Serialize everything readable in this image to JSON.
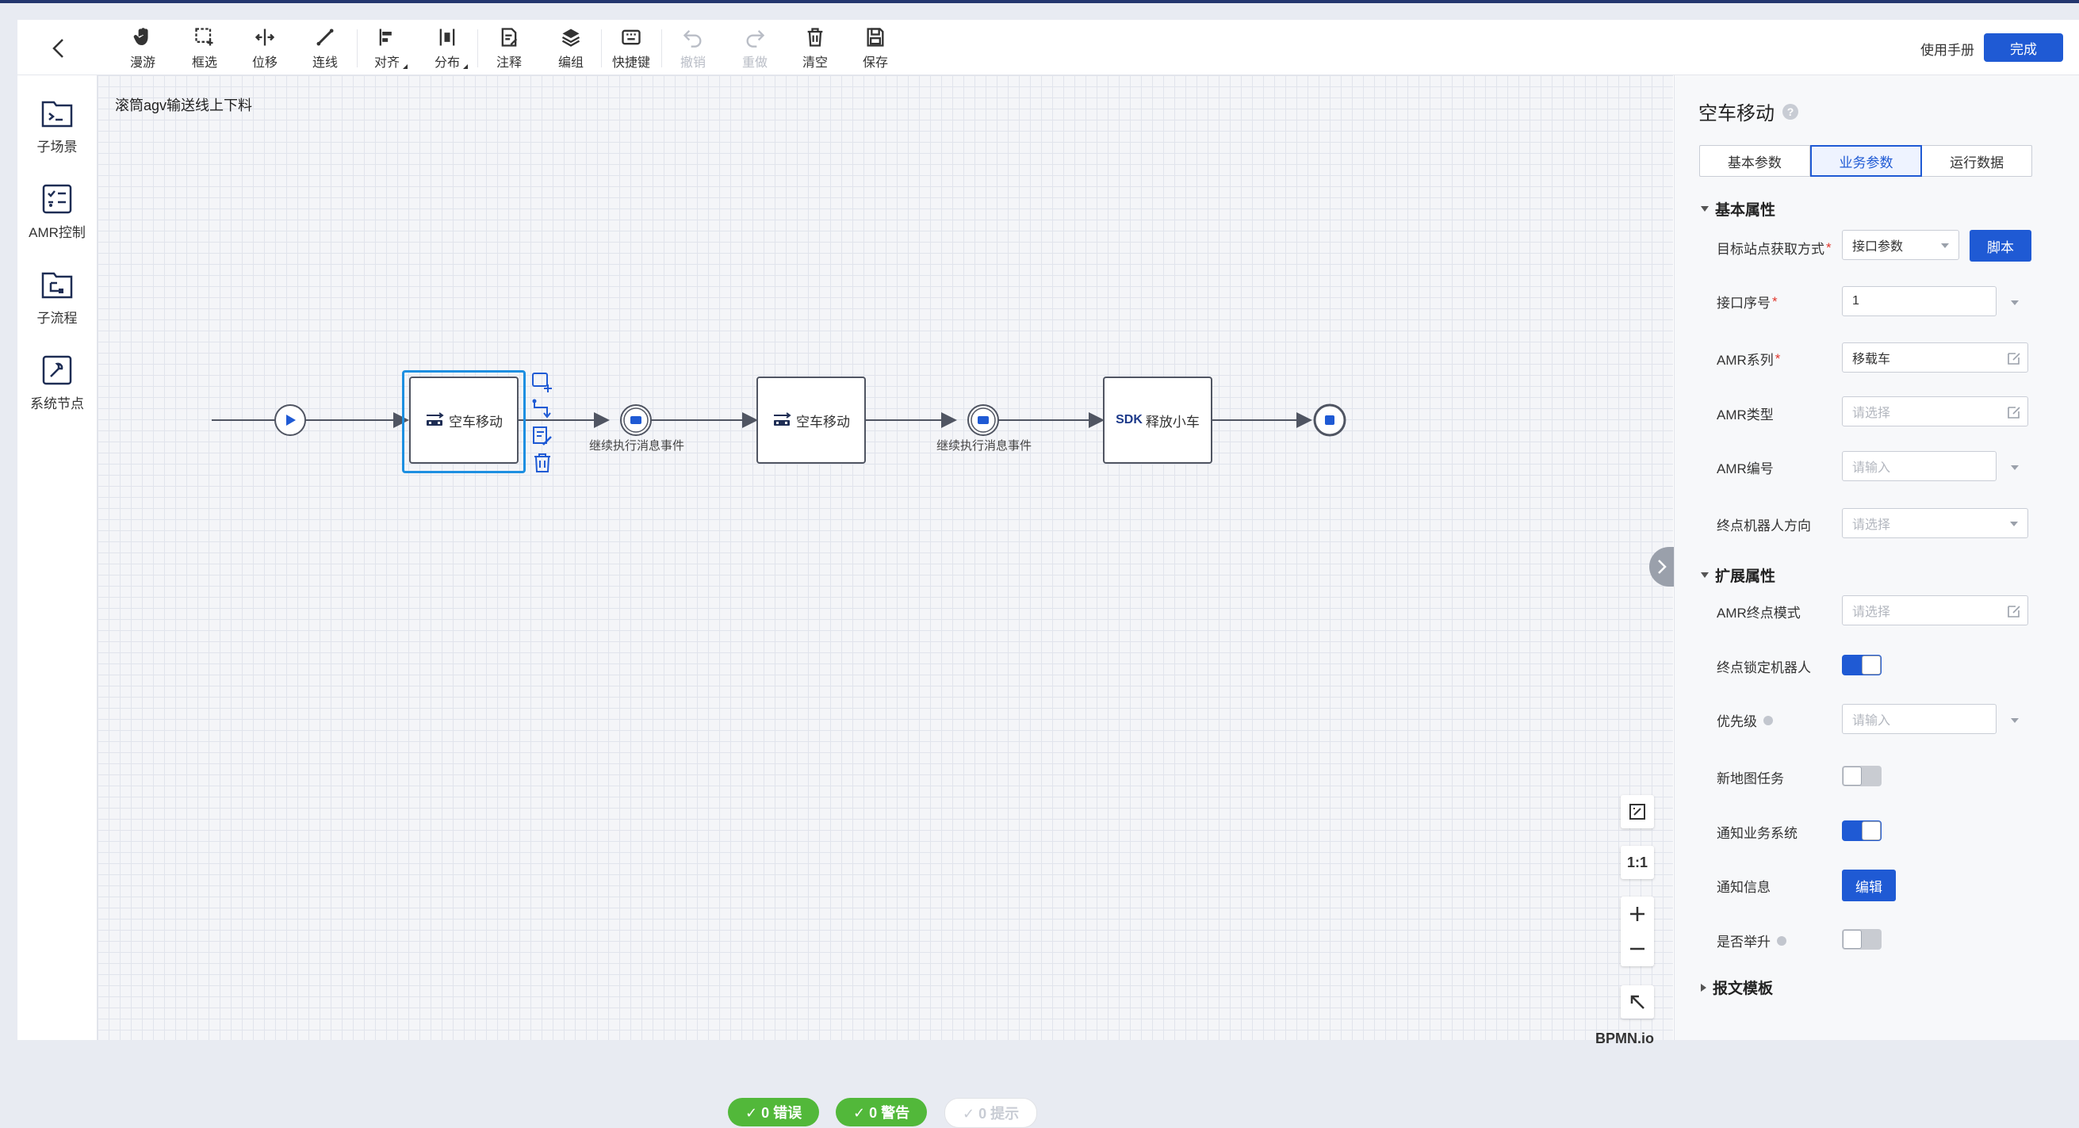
{
  "toolbar": {
    "tools": [
      {
        "id": "pan",
        "label": "漫游"
      },
      {
        "id": "marquee",
        "label": "框选"
      },
      {
        "id": "move",
        "label": "位移"
      },
      {
        "id": "connect",
        "label": "连线"
      },
      {
        "id": "align",
        "label": "对齐"
      },
      {
        "id": "distribute",
        "label": "分布"
      },
      {
        "id": "annotate",
        "label": "注释"
      },
      {
        "id": "group",
        "label": "编组"
      },
      {
        "id": "shortcut",
        "label": "快捷键"
      },
      {
        "id": "undo",
        "label": "撤销"
      },
      {
        "id": "redo",
        "label": "重做"
      },
      {
        "id": "clear",
        "label": "清空"
      },
      {
        "id": "save",
        "label": "保存"
      }
    ],
    "manual_label": "使用手册",
    "done_label": "完成"
  },
  "palette": {
    "items": [
      {
        "label": "子场景",
        "icon": "sub-scene-icon"
      },
      {
        "label": "AMR控制",
        "icon": "amr-control-icon"
      },
      {
        "label": "子流程",
        "icon": "sub-process-icon"
      },
      {
        "label": "系统节点",
        "icon": "system-node-icon"
      }
    ]
  },
  "canvas": {
    "title": "滚筒agv输送线上下料",
    "nodes": {
      "task1": "空车移动",
      "event1": "继续执行消息事件",
      "task2": "空车移动",
      "event2": "继续执行消息事件",
      "task3_prefix": "SDK",
      "task3": "释放小车"
    },
    "zoom": {
      "fit_label": "1:1"
    },
    "status_pills": {
      "errors": "✓ 0 错误",
      "warnings": "✓ 0 警告",
      "hints": "✓ 0 提示"
    },
    "bpmn_label": "BPMN.io"
  },
  "panel": {
    "title": "空车移动",
    "tabs": [
      {
        "label": "基本参数",
        "active": false
      },
      {
        "label": "业务参数",
        "active": true
      },
      {
        "label": "运行数据",
        "active": false
      }
    ],
    "section_basic": "基本属性",
    "section_ext": "扩展属性",
    "section_template": "报文模板",
    "fields": {
      "target_source": {
        "label": "目标站点获取方式",
        "value": "接口参数",
        "button": "脚本"
      },
      "iface_no": {
        "label": "接口序号",
        "value": "1"
      },
      "amr_series": {
        "label": "AMR系列",
        "value": "移载车"
      },
      "amr_type": {
        "label": "AMR类型",
        "placeholder": "请选择"
      },
      "amr_no": {
        "label": "AMR编号",
        "placeholder": "请输入"
      },
      "end_direction": {
        "label": "终点机器人方向",
        "placeholder": "请选择"
      },
      "amr_end_mode": {
        "label": "AMR终点模式",
        "placeholder": "请选择"
      },
      "end_lock": {
        "label": "终点锁定机器人",
        "on": true
      },
      "priority": {
        "label": "优先级",
        "placeholder": "请输入"
      },
      "new_map_task": {
        "label": "新地图任务",
        "on": false
      },
      "notify_system": {
        "label": "通知业务系统",
        "on": true
      },
      "notify_info": {
        "label": "通知信息",
        "button": "编辑"
      },
      "lift": {
        "label": "是否举升",
        "on": false
      }
    }
  },
  "colors": {
    "primary": "#1f5ad4",
    "selection": "#1d8fe1",
    "pass_green": "#52b83a"
  }
}
